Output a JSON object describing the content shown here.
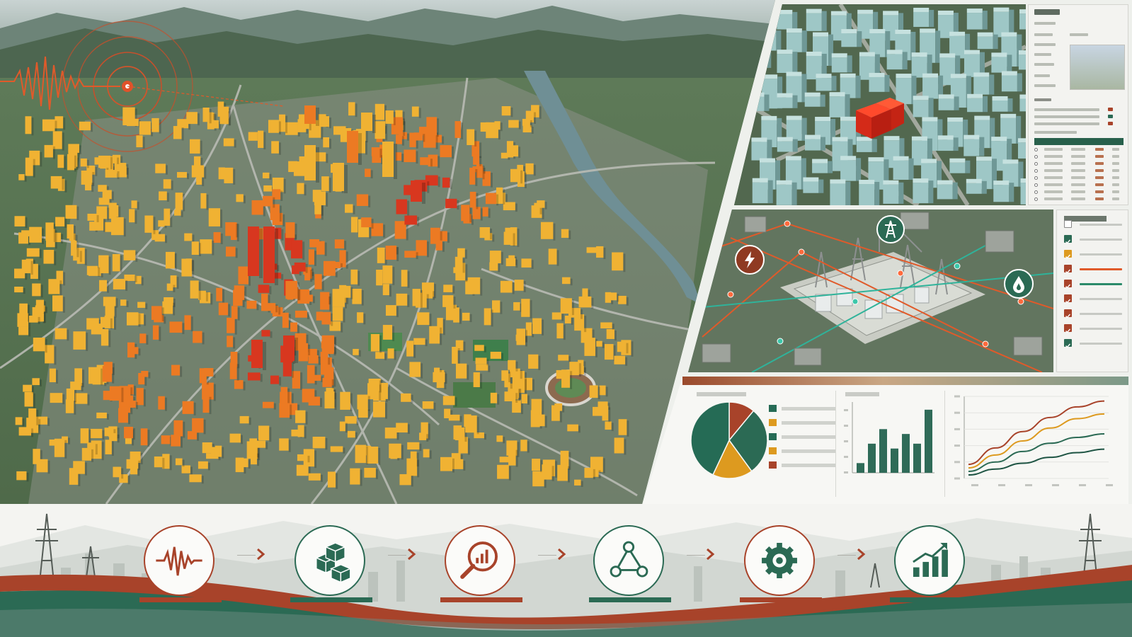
{
  "colors": {
    "accent_rust": "#a8432a",
    "accent_green": "#2b6a54",
    "accent_gold": "#dd9a1f",
    "building_yellow": "#f0b233",
    "building_orange": "#ec7a23",
    "building_red": "#d8371f",
    "panel_bg": "#f6f6f3"
  },
  "icons": {
    "epicenter": "seismic-wave-icon",
    "power": "lightning-bolt-icon",
    "tower": "power-tower-icon",
    "water": "water-drop-icon"
  },
  "process_steps": [
    {
      "icon": "seismic-wave-icon",
      "bar_color": "#a8432a"
    },
    {
      "icon": "building-cubes-icon",
      "bar_color": "#2b6a54"
    },
    {
      "icon": "magnify-chart-icon",
      "bar_color": "#a8432a"
    },
    {
      "icon": "network-nodes-icon",
      "bar_color": "#2b6a54"
    },
    {
      "icon": "gear-icon",
      "bar_color": "#a8432a"
    },
    {
      "icon": "growth-chart-icon",
      "bar_color": "#2b6a54"
    }
  ],
  "chart_data": [
    {
      "type": "pie",
      "values": [
        11,
        29,
        17,
        43
      ],
      "colors": [
        "#a8432a",
        "#2b6a54",
        "#dd9a1f",
        "#256b55"
      ],
      "legend_colors": [
        "#256b55",
        "#dd9a1f",
        "#256b55",
        "#dd9a1f",
        "#a8432a"
      ]
    },
    {
      "type": "bar",
      "values": [
        1,
        3,
        4.5,
        2.5,
        4,
        3,
        6.5
      ],
      "ylim": [
        0,
        7
      ]
    },
    {
      "type": "line",
      "series": [
        {
          "color": "#a8432a",
          "values": [
            1.2,
            2.6,
            4.0,
            5.2,
            6.1,
            6.6
          ]
        },
        {
          "color": "#dd9a1f",
          "values": [
            0.9,
            2.0,
            3.2,
            4.3,
            5.1,
            5.5
          ]
        },
        {
          "color": "#2b6a54",
          "values": [
            0.6,
            1.4,
            2.3,
            3.0,
            3.5,
            3.8
          ]
        },
        {
          "color": "#1e5443",
          "values": [
            0.3,
            0.8,
            1.3,
            1.8,
            2.2,
            2.5
          ]
        }
      ],
      "ylim": [
        0,
        7
      ]
    }
  ]
}
